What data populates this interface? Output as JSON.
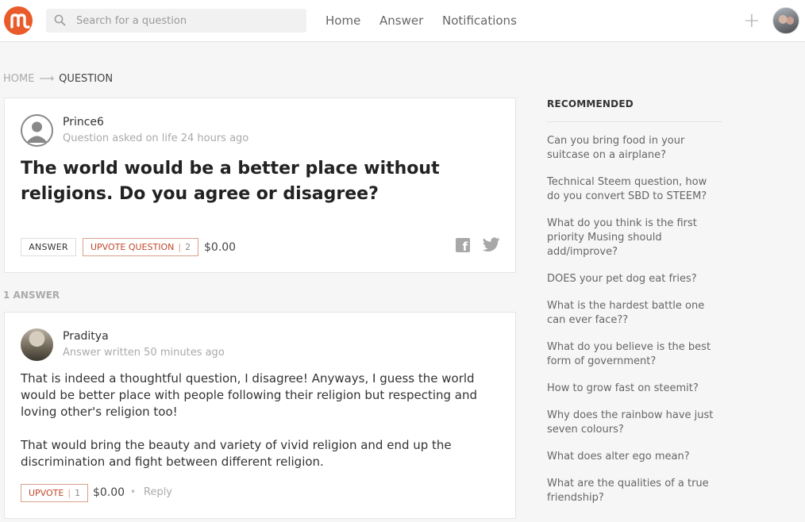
{
  "header": {
    "logo_icon": "musing-logo-icon",
    "search_placeholder": "Search for a question",
    "nav": [
      "Home",
      "Answer",
      "Notifications"
    ],
    "plus_icon": "+",
    "accent_color": "#ea5b2b"
  },
  "breadcrumb": {
    "home": "HOME",
    "arrow": "⟶",
    "current": "QUESTION"
  },
  "question": {
    "author": "Prince6",
    "meta": "Question asked on life 24 hours ago",
    "title": "The world would be a better place without religions. Do you agree or disagree?",
    "answer_button": "ANSWER",
    "upvote_label": "UPVOTE QUESTION",
    "upvote_count": "2",
    "payout": "$0.00"
  },
  "answers_count_label": "1 ANSWER",
  "answer": {
    "author": "Praditya",
    "meta": "Answer written 50 minutes ago",
    "paragraph1": "That is indeed a thoughtful question, I disagree! Anyways, I guess the world would be better place with people following their religion but respecting and loving other's religion too!",
    "paragraph2": "That would bring the beauty and variety of vivid religion and end up the discrimination and fight between different religion.",
    "upvote_label": "UPVOTE",
    "upvote_count": "1",
    "payout": "$0.00",
    "dot": "•",
    "reply": "Reply"
  },
  "recommended": {
    "heading": "RECOMMENDED",
    "items": [
      "Can you bring food in your suitcase on a airplane?",
      "Technical Steem question, how do you convert SBD to STEEM?",
      "What do you think is the first priority Musing should add/improve?",
      "DOES your pet dog eat fries?",
      "What is the hardest battle one can ever face??",
      "What do you believe is the best form of government?",
      "How to grow fast on steemit?",
      "Why does the rainbow have just seven colours?",
      "What does alter ego mean?",
      "What are the qualities of a true friendship?"
    ]
  }
}
